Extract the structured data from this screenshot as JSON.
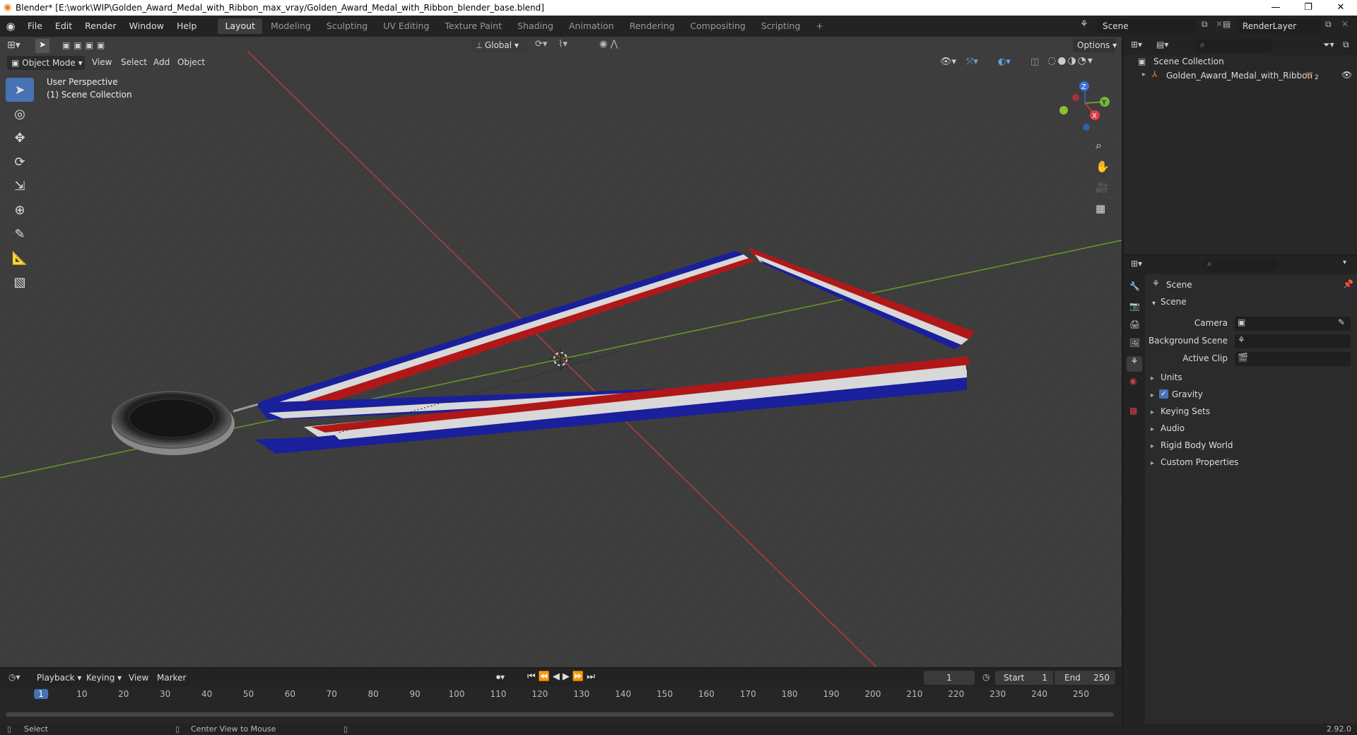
{
  "window": {
    "title": "Blender* [E:\\work\\WIP\\Golden_Award_Medal_with_Ribbon_max_vray/Golden_Award_Medal_with_Ribbon_blender_base.blend]",
    "minimize": "—",
    "maximize": "❐",
    "close": "✕"
  },
  "menu": [
    "File",
    "Edit",
    "Render",
    "Window",
    "Help"
  ],
  "workspaces": [
    "Layout",
    "Modeling",
    "Sculpting",
    "UV Editing",
    "Texture Paint",
    "Shading",
    "Animation",
    "Rendering",
    "Compositing",
    "Scripting"
  ],
  "active_workspace": "Layout",
  "add_workspace": "+",
  "scene_name": "Scene",
  "render_layer": "RenderLayer",
  "viewport": {
    "mode": "Object Mode",
    "menus": [
      "View",
      "Select",
      "Add",
      "Object"
    ],
    "transform_orientation": "Global",
    "options_label": "Options",
    "overlay_text1": "User Perspective",
    "overlay_text2": "(1) Scene Collection",
    "gizmo_axes": [
      "Z",
      "Y",
      "X"
    ]
  },
  "outliner": {
    "root": "Scene Collection",
    "items": [
      "Golden_Award_Medal_with_Ribbon"
    ],
    "object_badge": "2"
  },
  "properties": {
    "header": "Scene",
    "section": "Scene",
    "fields": [
      {
        "label": "Camera"
      },
      {
        "label": "Background Scene"
      },
      {
        "label": "Active Clip"
      }
    ],
    "panels": [
      "Units",
      "Gravity",
      "Keying Sets",
      "Audio",
      "Rigid Body World",
      "Custom Properties"
    ],
    "gravity_checked": true
  },
  "timeline": {
    "menus": [
      "Playback",
      "Keying",
      "View",
      "Marker"
    ],
    "current_frame": "1",
    "start_label": "Start",
    "start": "1",
    "end_label": "End",
    "end": "250",
    "ticks": [
      "1",
      "10",
      "20",
      "30",
      "40",
      "50",
      "60",
      "70",
      "80",
      "90",
      "100",
      "110",
      "120",
      "130",
      "140",
      "150",
      "160",
      "170",
      "180",
      "190",
      "200",
      "210",
      "220",
      "230",
      "240",
      "250"
    ]
  },
  "status": {
    "left": "Select",
    "middle": "Center View to Mouse",
    "version": "2.92.0"
  },
  "colors": {
    "accent": "#4772b3",
    "ribbon_red": "#b01818",
    "ribbon_blue": "#1a1f9c",
    "ribbon_white": "#d8d8d8",
    "x_axis": "#b73a3a",
    "y_axis": "#6a9a2a"
  }
}
